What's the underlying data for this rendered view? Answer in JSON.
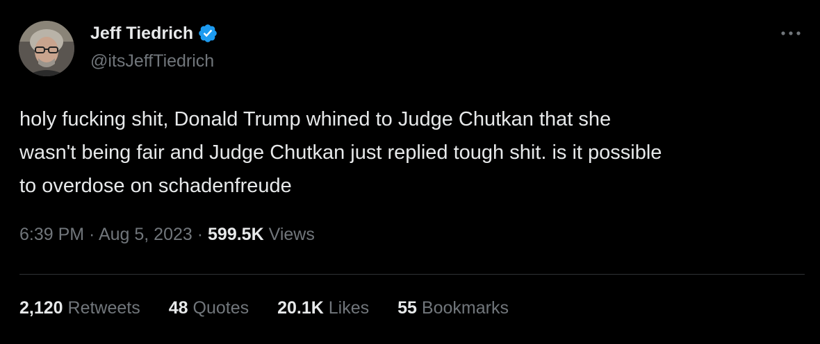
{
  "author": {
    "display_name": "Jeff Tiedrich",
    "handle": "@itsJeffTiedrich",
    "verified_color": "#1d9bf0",
    "avatar": "avatar-photo"
  },
  "more_icon": "ellipsis-horizontal-icon",
  "tweet": {
    "lines": [
      "holy fucking shit, Donald Trump whined to Judge Chutkan that she",
      "wasn't being fair and Judge Chutkan just replied tough shit. is it possible",
      "to overdose on schadenfreude"
    ]
  },
  "meta": {
    "time": "6:39 PM",
    "sep1": " · ",
    "date": "Aug 5, 2023",
    "sep2": " · ",
    "views_count": "599.5K",
    "views_label": "Views"
  },
  "stats": {
    "retweets": {
      "count": "2,120",
      "label": "Retweets"
    },
    "quotes": {
      "count": "48",
      "label": "Quotes"
    },
    "likes": {
      "count": "20.1K",
      "label": "Likes"
    },
    "bookmarks": {
      "count": "55",
      "label": "Bookmarks"
    }
  },
  "colors": {
    "background": "#000000",
    "primary_text": "#e7e9ea",
    "secondary_text": "#71767b",
    "divider": "#2f3336"
  }
}
